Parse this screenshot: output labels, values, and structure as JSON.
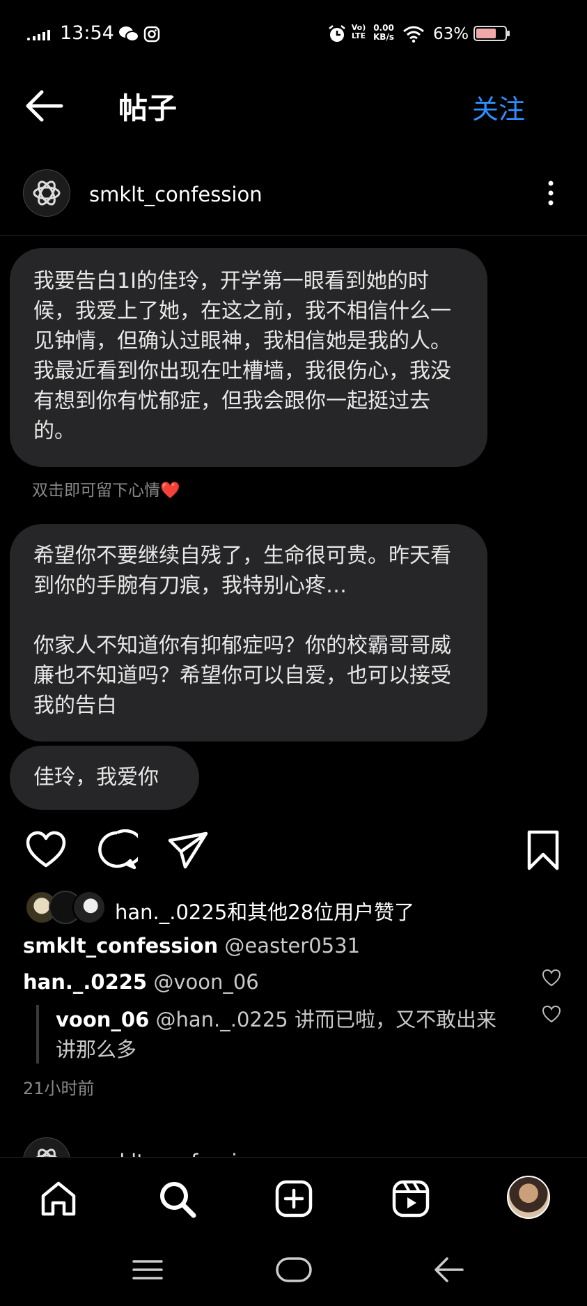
{
  "status_bar": {
    "time": "13:54",
    "battery": "63%",
    "battery_level": 0.63,
    "net_speed_value": "0.00",
    "net_speed_unit": "KB/s",
    "volte": "Vo) LTE"
  },
  "header": {
    "title": "帖子",
    "follow_label": "关注"
  },
  "post": {
    "author": "smklt_confession",
    "bubble1": "我要告白1I的佳玲，开学第一眼看到她的时候，我爱上了她，在这之前，我不相信什么一见钟情，但确认过眼神，我相信她是我的人。我最近看到你出现在吐槽墙，我很伤心，我没有想到你有忧郁症，但我会跟你一起挺过去的。",
    "double_tap_hint": "双击即可留下心情❤️",
    "bubble2_p1": "希望你不要继续自残了，生命很可贵。昨天看到你的手腕有刀痕，我特别心疼…",
    "bubble2_p2": "你家人不知道你有抑郁症吗？你的校霸哥哥威廉也不知道吗？希望你可以自爱，也可以接受我的告白",
    "bubble3": "佳玲，我爱你",
    "likes_text": "han._.0225和其他28位用户赞了",
    "caption_user": "smklt_confession",
    "caption_text": "@easter0531",
    "comments": [
      {
        "user": "han._.0225",
        "text": "@voon_06"
      },
      {
        "user": "voon_06",
        "text": "@han._.0225 讲而已啦，又不敢出来讲那么多"
      }
    ],
    "time_ago": "21小时前"
  },
  "next_post": {
    "author": "smklt_confession"
  },
  "colors": {
    "accent": "#2e8fff",
    "bubble": "#262628",
    "background": "#000000"
  }
}
